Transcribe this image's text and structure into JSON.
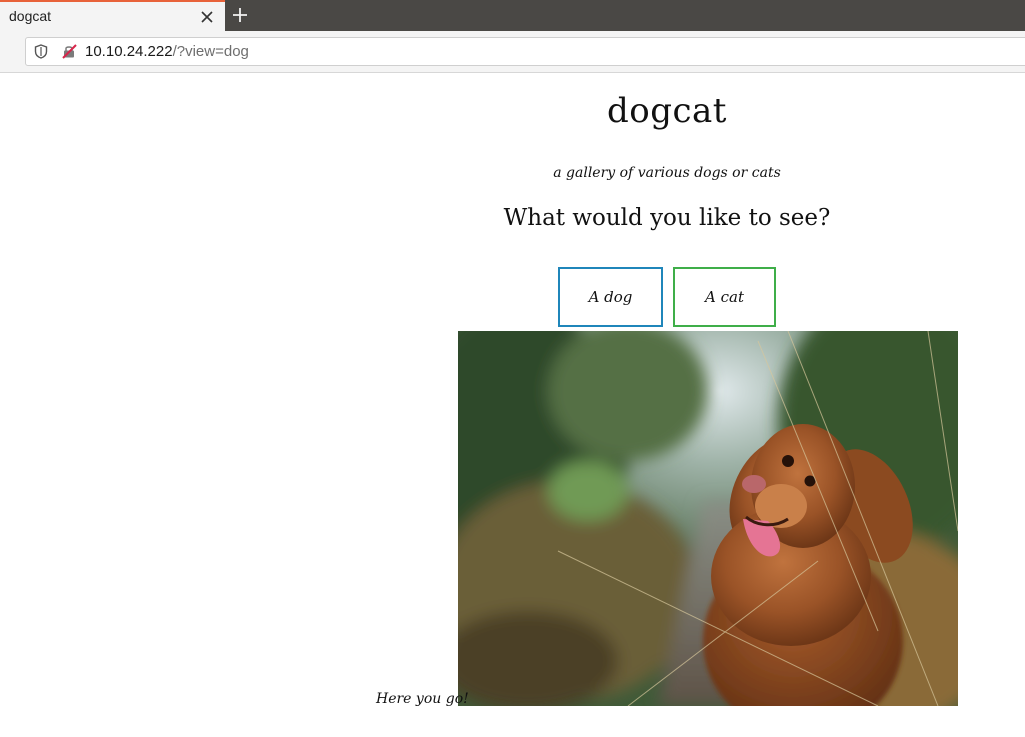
{
  "browser": {
    "tab_title": "dogcat",
    "url_host": "10.10.24.222",
    "url_rest": "/?view=dog"
  },
  "page": {
    "title": "dogcat",
    "subtitle": "a gallery of various dogs or cats",
    "question": "What would you like to see?",
    "buttons": {
      "dog": "A dog",
      "cat": "A cat"
    },
    "caption": "Here you go!"
  },
  "icons": {
    "tab_close": "close-icon",
    "new_tab": "plus-icon",
    "tracking": "shield-icon",
    "connection": "insecure-lock-icon"
  },
  "colors": {
    "dog_button_border": "#1f86ba",
    "cat_button_border": "#3fae49",
    "tab_accent": "#e8623a"
  }
}
